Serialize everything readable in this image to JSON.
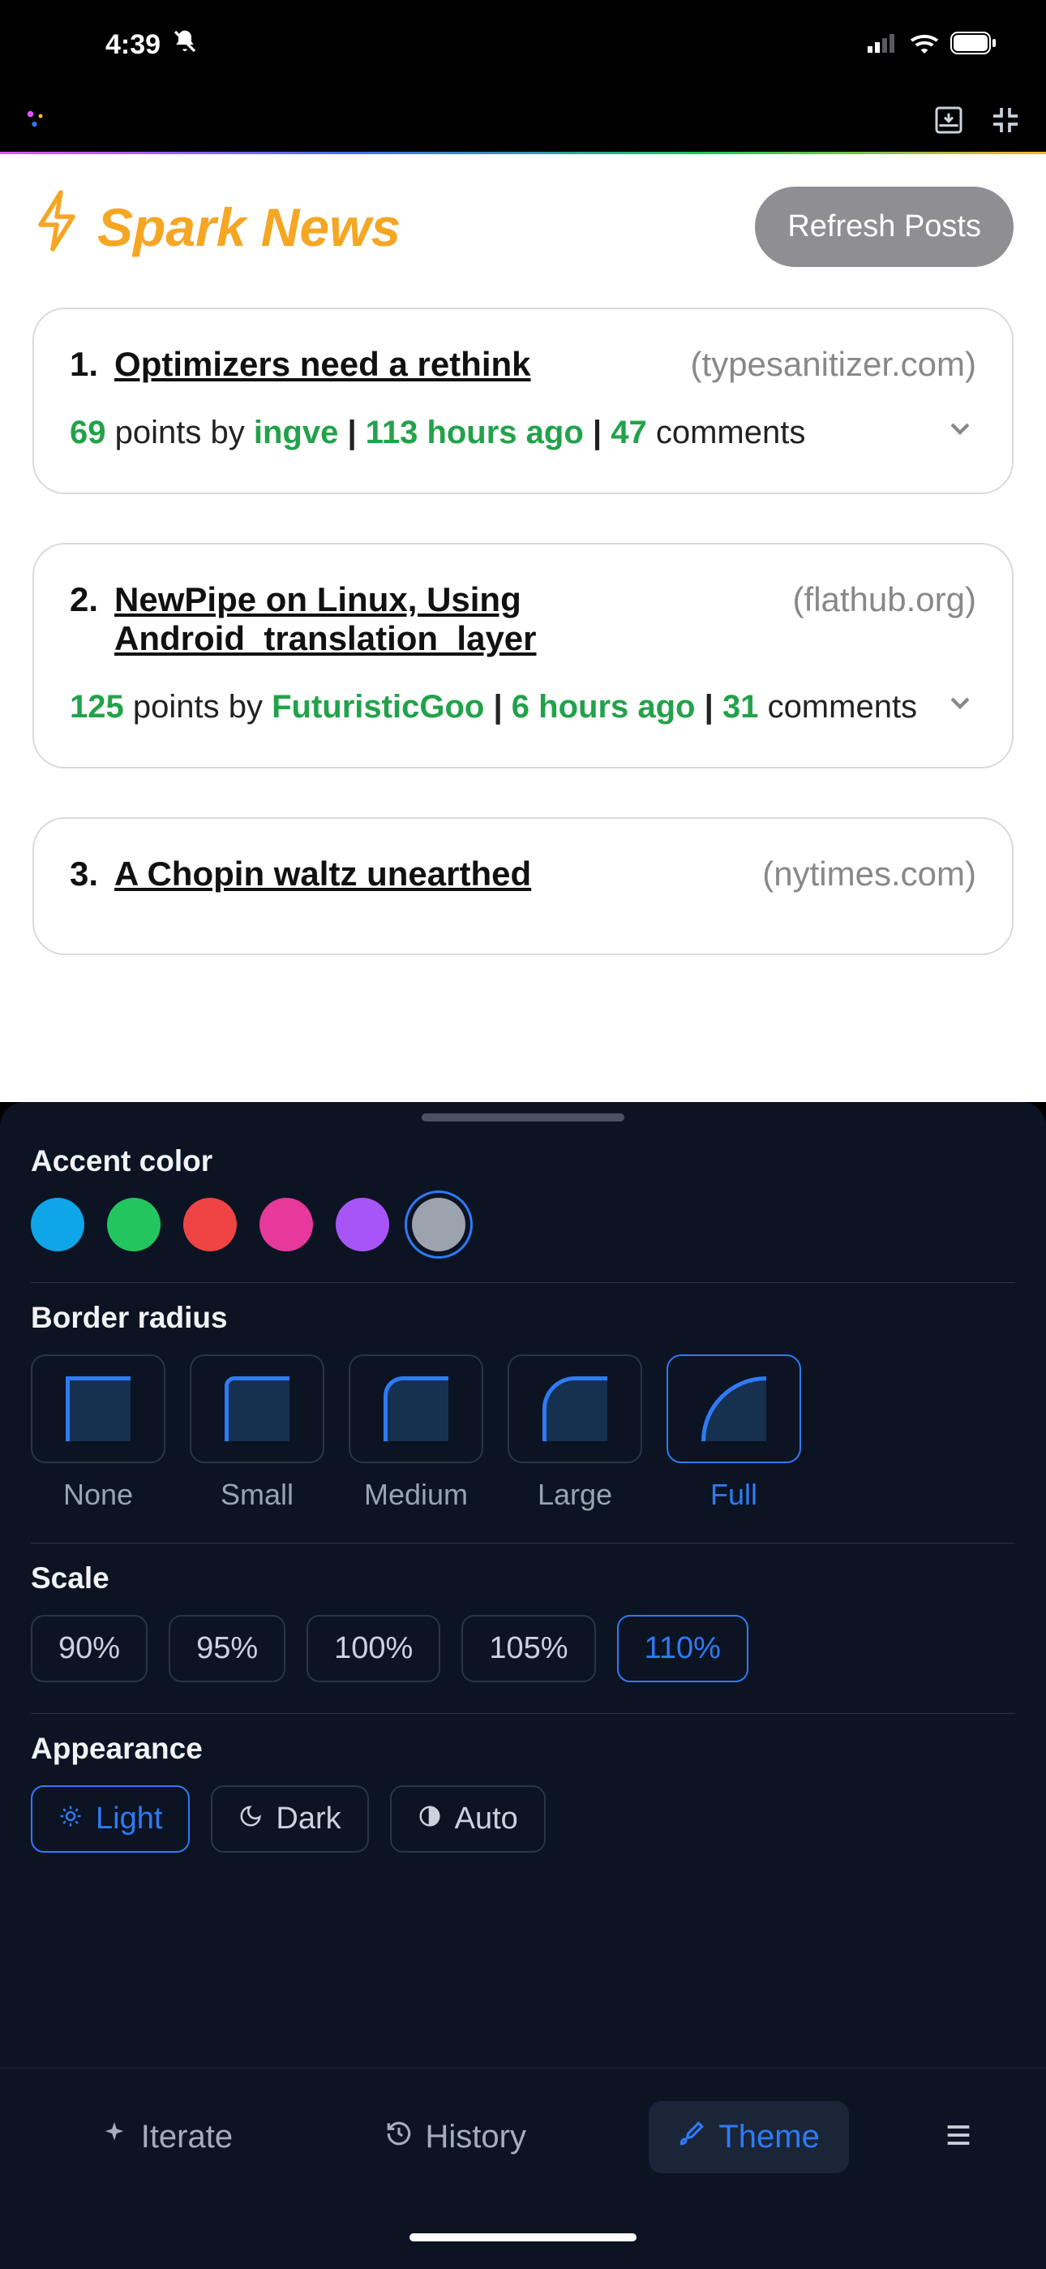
{
  "status": {
    "time": "4:39"
  },
  "app": {
    "title": "Spark News",
    "refresh_label": "Refresh Posts"
  },
  "posts": [
    {
      "rank": "1.",
      "title": "Optimizers need a rethink",
      "domain": "(typesanitizer.com)",
      "points": "69",
      "by_label": "points by",
      "author": "ingve",
      "age": "113 hours ago",
      "comments_count": "47",
      "comments_label": "comments"
    },
    {
      "rank": "2.",
      "title": "NewPipe on Linux, Using Android_translation_layer",
      "domain": "(flathub.org)",
      "points": "125",
      "by_label": "points by",
      "author": "FuturisticGoo",
      "age": "6 hours ago",
      "comments_count": "31",
      "comments_label": "comments"
    },
    {
      "rank": "3.",
      "title": "A Chopin waltz unearthed",
      "domain": "(nytimes.com)"
    }
  ],
  "theme": {
    "accent_label": "Accent color",
    "accent_colors": [
      "#0ea5e9",
      "#22c55e",
      "#ef4444",
      "#e6399b",
      "#a855f7",
      "#9ca3af"
    ],
    "accent_selected_index": 5,
    "radius_label": "Border radius",
    "radius_options": [
      {
        "label": "None",
        "radius": "0px"
      },
      {
        "label": "Small",
        "radius": "12px"
      },
      {
        "label": "Medium",
        "radius": "24px"
      },
      {
        "label": "Large",
        "radius": "40px"
      },
      {
        "label": "Full",
        "radius": "80px"
      }
    ],
    "radius_selected_index": 4,
    "scale_label": "Scale",
    "scale_options": [
      "90%",
      "95%",
      "100%",
      "105%",
      "110%"
    ],
    "scale_selected_index": 4,
    "appearance_label": "Appearance",
    "appearance_options": [
      "Light",
      "Dark",
      "Auto"
    ],
    "appearance_selected_index": 0
  },
  "tabs": {
    "iterate": "Iterate",
    "history": "History",
    "theme": "Theme"
  }
}
